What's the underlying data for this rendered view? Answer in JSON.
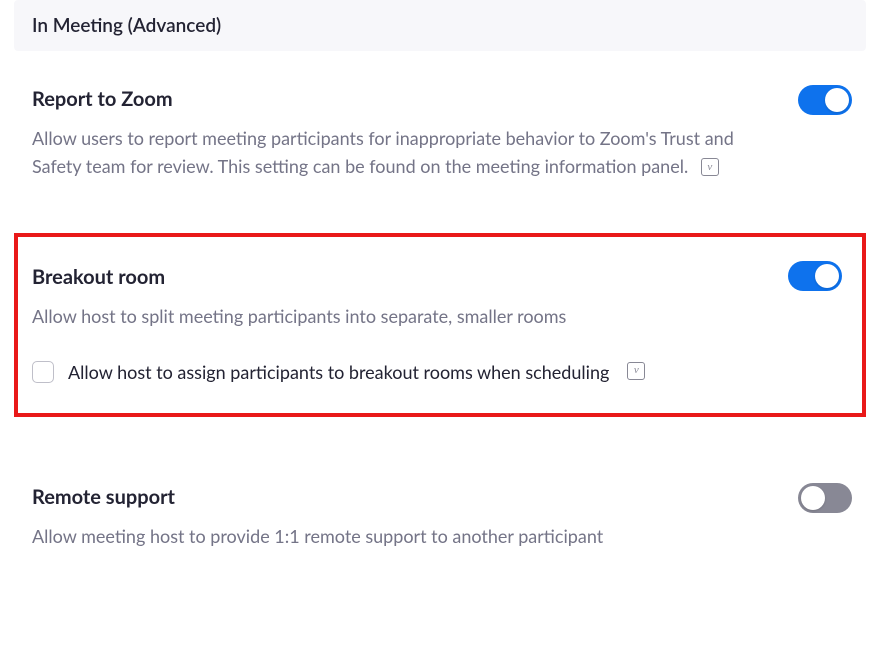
{
  "header": {
    "title": "In Meeting (Advanced)"
  },
  "settings": {
    "report": {
      "title": "Report to Zoom",
      "desc": "Allow users to report meeting participants for inappropriate behavior to Zoom's Trust and Safety team for review. This setting can be found on the meeting information panel.",
      "enabled": true
    },
    "breakout": {
      "title": "Breakout room",
      "desc": "Allow host to split meeting participants into separate, smaller rooms",
      "enabled": true,
      "sub": {
        "checked": false,
        "label": "Allow host to assign participants to breakout rooms when scheduling"
      }
    },
    "remote": {
      "title": "Remote support",
      "desc": "Allow meeting host to provide 1:1 remote support to another participant",
      "enabled": false
    }
  },
  "icons": {
    "info_glyph": "v"
  }
}
